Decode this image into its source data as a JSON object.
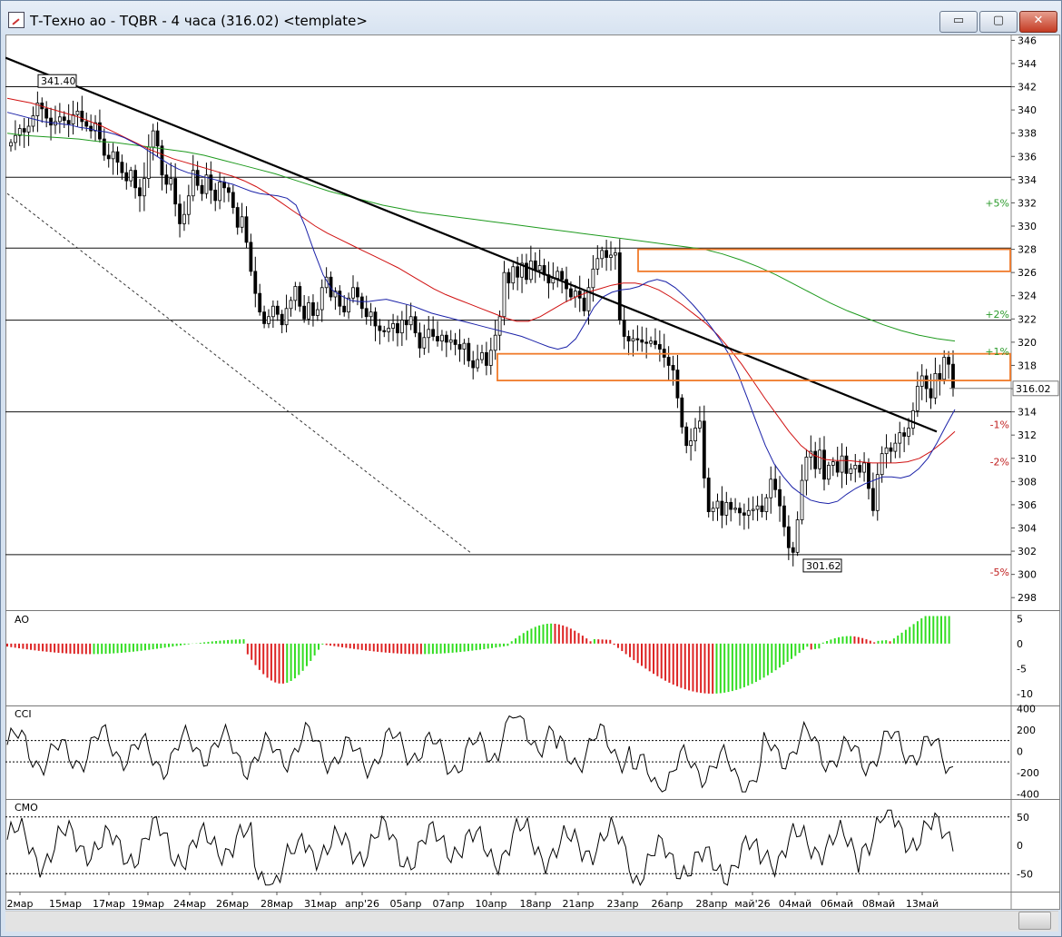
{
  "window": {
    "title": "Т-Техно ао - TQBR - 4 часа (316.02) <template>",
    "buttons": {
      "minimize": "▭",
      "maximize": "▢",
      "close": "✕"
    }
  },
  "chart_data": {
    "type": "candlestick",
    "instrument": "Т-Техно ао",
    "board": "TQBR",
    "timeframe": "4 часа",
    "last_price": 316.02,
    "last_price_label": "316.02",
    "max_label": "341.40",
    "min_label": "301.62",
    "price_axis": {
      "min": 297,
      "max": 346.5,
      "ticks": [
        298,
        300,
        302,
        304,
        306,
        308,
        310,
        312,
        314,
        316,
        318,
        320,
        322,
        324,
        326,
        328,
        330,
        332,
        334,
        336,
        338,
        340,
        342,
        344,
        346
      ]
    },
    "x_labels": [
      "2мар",
      "15мар",
      "17мар",
      "19мар",
      "24мар",
      "26мар",
      "28мар",
      "31мар",
      "апр'26",
      "05апр",
      "07апр",
      "10апр",
      "18апр",
      "21апр",
      "23апр",
      "26апр",
      "28апр",
      "май'26",
      "04май",
      "06май",
      "08май",
      "13май"
    ],
    "horizontal_levels": [
      342.0,
      334.2,
      328.1,
      321.9,
      314.0,
      301.7
    ],
    "zones": [
      {
        "from": 326.1,
        "to": 328.0,
        "color": "#f07a2a"
      },
      {
        "from": 316.7,
        "to": 319.0,
        "color": "#f07a2a"
      }
    ],
    "percent_labels": [
      {
        "text": "+5%",
        "price": 332.0,
        "color": "#2a9a2a"
      },
      {
        "text": "+2%",
        "price": 322.4,
        "color": "#2a9a2a"
      },
      {
        "text": "+1%",
        "price": 319.2,
        "color": "#2a9a2a"
      },
      {
        "text": "-1%",
        "price": 312.9,
        "color": "#c02020"
      },
      {
        "text": "-2%",
        "price": 309.7,
        "color": "#c02020"
      },
      {
        "text": "-5%",
        "price": 300.2,
        "color": "#c02020"
      }
    ],
    "closes": [
      337.2,
      337.8,
      338.4,
      338.1,
      338.6,
      339.5,
      340.6,
      340.1,
      339.3,
      338.7,
      339.0,
      339.4,
      339.1,
      338.8,
      339.6,
      339.9,
      339.0,
      338.6,
      338.2,
      338.9,
      337.5,
      336.1,
      335.8,
      336.4,
      335.5,
      334.6,
      333.9,
      334.8,
      333.3,
      332.6,
      334.1,
      336.8,
      338.2,
      336.9,
      334.4,
      333.6,
      334.1,
      331.9,
      330.2,
      331.0,
      332.6,
      334.8,
      333.5,
      332.8,
      334.4,
      333.1,
      332.2,
      333.8,
      333.3,
      332.9,
      331.6,
      329.9,
      330.8,
      328.6,
      326.1,
      324.2,
      322.6,
      321.6,
      322.2,
      323.1,
      322.4,
      321.5,
      322.9,
      323.6,
      324.8,
      323.1,
      322.0,
      323.4,
      322.3,
      322.8,
      324.7,
      325.6,
      323.9,
      324.4,
      323.1,
      322.6,
      323.8,
      324.7,
      323.9,
      322.9,
      322.2,
      322.6,
      321.4,
      321.0,
      320.9,
      321.2,
      321.6,
      320.8,
      321.9,
      321.5,
      322.2,
      320.8,
      319.5,
      320.4,
      321.1,
      320.5,
      320.1,
      320.6,
      320.0,
      320.2,
      319.8,
      319.4,
      319.9,
      318.4,
      317.8,
      318.5,
      319.1,
      318.0,
      319.3,
      320.6,
      322.2,
      326.0,
      325.1,
      326.5,
      325.6,
      326.8,
      325.4,
      327.0,
      326.2,
      326.6,
      325.8,
      325.1,
      325.5,
      326.1,
      325.4,
      324.6,
      323.9,
      324.4,
      323.8,
      322.7,
      324.7,
      326.3,
      327.2,
      327.9,
      327.3,
      327.5,
      327.7,
      321.9,
      320.5,
      320.1,
      320.3,
      320.2,
      320.0,
      319.9,
      320.1,
      319.8,
      319.4,
      318.7,
      318.0,
      317.6,
      315.2,
      312.7,
      311.1,
      311.5,
      312.6,
      313.2,
      308.3,
      305.4,
      305.7,
      306.3,
      305.1,
      306.2,
      305.6,
      305.7,
      305.3,
      305.1,
      305.5,
      305.6,
      305.9,
      305.4,
      306.6,
      308.2,
      307.3,
      305.9,
      304.1,
      302.3,
      301.9,
      304.7,
      308.1,
      310.1,
      310.6,
      309.1,
      310.7,
      308.2,
      309.4,
      309.7,
      308.8,
      310.2,
      308.7,
      309.1,
      309.4,
      308.8,
      309.6,
      307.4,
      305.5,
      308.6,
      310.4,
      310.9,
      310.6,
      311.3,
      312.2,
      311.9,
      312.6,
      314.1,
      316.2,
      317.1,
      316.0,
      315.2,
      317.3,
      316.8,
      318.7,
      318.1,
      316.02
    ],
    "ma_blue": [
      339.8,
      339.6,
      339.4,
      339.2,
      339.0,
      338.9,
      338.8,
      338.7,
      338.5,
      338.4,
      338.2,
      338.1,
      337.9,
      337.6,
      337.2,
      336.8,
      336.3,
      335.8,
      335.3,
      334.9,
      334.6,
      334.4,
      334.2,
      334.0,
      333.8,
      333.6,
      333.3,
      333.0,
      332.8,
      332.7,
      332.6,
      332.4,
      331.8,
      330.0,
      327.8,
      325.8,
      324.5,
      324.0,
      323.6,
      323.5,
      323.5,
      323.6,
      323.7,
      323.5,
      323.3,
      323.1,
      322.8,
      322.5,
      322.3,
      322.1,
      321.9,
      321.7,
      321.5,
      321.3,
      321.1,
      320.9,
      320.7,
      320.5,
      320.2,
      319.9,
      319.6,
      319.4,
      319.6,
      320.3,
      321.6,
      323.0,
      323.9,
      324.3,
      324.5,
      324.6,
      324.8,
      325.2,
      325.4,
      325.2,
      324.7,
      324.0,
      323.2,
      322.3,
      321.3,
      320.2,
      318.9,
      317.2,
      315.2,
      313.1,
      311.1,
      309.5,
      308.4,
      307.5,
      306.9,
      306.4,
      306.2,
      306.1,
      306.3,
      306.9,
      307.4,
      307.8,
      308.1,
      308.4,
      308.4,
      308.3,
      308.5,
      309.1,
      310.0,
      311.3,
      312.8,
      314.2
    ],
    "ma_red": [
      341.0,
      340.8,
      340.6,
      340.3,
      340.0,
      339.7,
      339.4,
      339.0,
      338.6,
      338.1,
      337.6,
      337.1,
      336.6,
      336.2,
      335.8,
      335.5,
      335.2,
      334.9,
      334.6,
      334.3,
      333.9,
      333.4,
      332.8,
      332.1,
      331.4,
      330.7,
      330.0,
      329.4,
      328.9,
      328.4,
      327.9,
      327.4,
      326.9,
      326.4,
      325.8,
      325.2,
      324.6,
      324.1,
      323.7,
      323.3,
      322.9,
      322.5,
      322.1,
      321.8,
      321.8,
      322.2,
      322.8,
      323.4,
      323.9,
      324.3,
      324.6,
      324.9,
      325.1,
      325.1,
      324.9,
      324.5,
      323.9,
      323.2,
      322.4,
      321.6,
      320.6,
      319.4,
      318.1,
      316.6,
      315.1,
      313.7,
      312.3,
      311.1,
      310.3,
      309.9,
      309.8,
      309.8,
      309.7,
      309.6,
      309.6,
      309.6,
      309.7,
      310.0,
      310.6,
      311.4,
      312.3
    ],
    "ma_green": [
      338.0,
      337.8,
      337.7,
      337.6,
      337.5,
      337.3,
      337.2,
      337.0,
      336.8,
      336.6,
      336.4,
      336.1,
      335.7,
      335.3,
      334.9,
      334.5,
      334.0,
      333.5,
      333.0,
      332.6,
      332.2,
      331.8,
      331.5,
      331.2,
      331.0,
      330.8,
      330.6,
      330.4,
      330.2,
      330.0,
      329.8,
      329.6,
      329.4,
      329.2,
      329.0,
      328.8,
      328.6,
      328.4,
      328.2,
      328.0,
      327.6,
      327.1,
      326.5,
      325.8,
      325.0,
      324.2,
      323.4,
      322.7,
      322.1,
      321.5,
      321.0,
      320.6,
      320.3,
      320.1
    ],
    "indicators": {
      "ao": {
        "label": "AO",
        "axis_ticks": [
          "5",
          "0",
          "-5",
          "-10"
        ],
        "range": [
          -12,
          6.5
        ]
      },
      "cci": {
        "label": "CCI",
        "axis_ticks": [
          "400",
          "200",
          "0",
          "-200",
          "-400"
        ],
        "levels": [
          100,
          -100
        ],
        "range": [
          -430,
          420
        ]
      },
      "cmo": {
        "label": "CMO",
        "axis_ticks": [
          "50",
          "0",
          "-50"
        ],
        "levels": [
          50,
          -50
        ],
        "range": [
          -80,
          80
        ]
      }
    }
  },
  "colors": {
    "up": "#33dd22",
    "down": "#dd2222",
    "zone": "#f07a2a",
    "blue_ma": "#1b22a8",
    "red_ma": "#d01010",
    "green_ma": "#1e9a1e"
  }
}
